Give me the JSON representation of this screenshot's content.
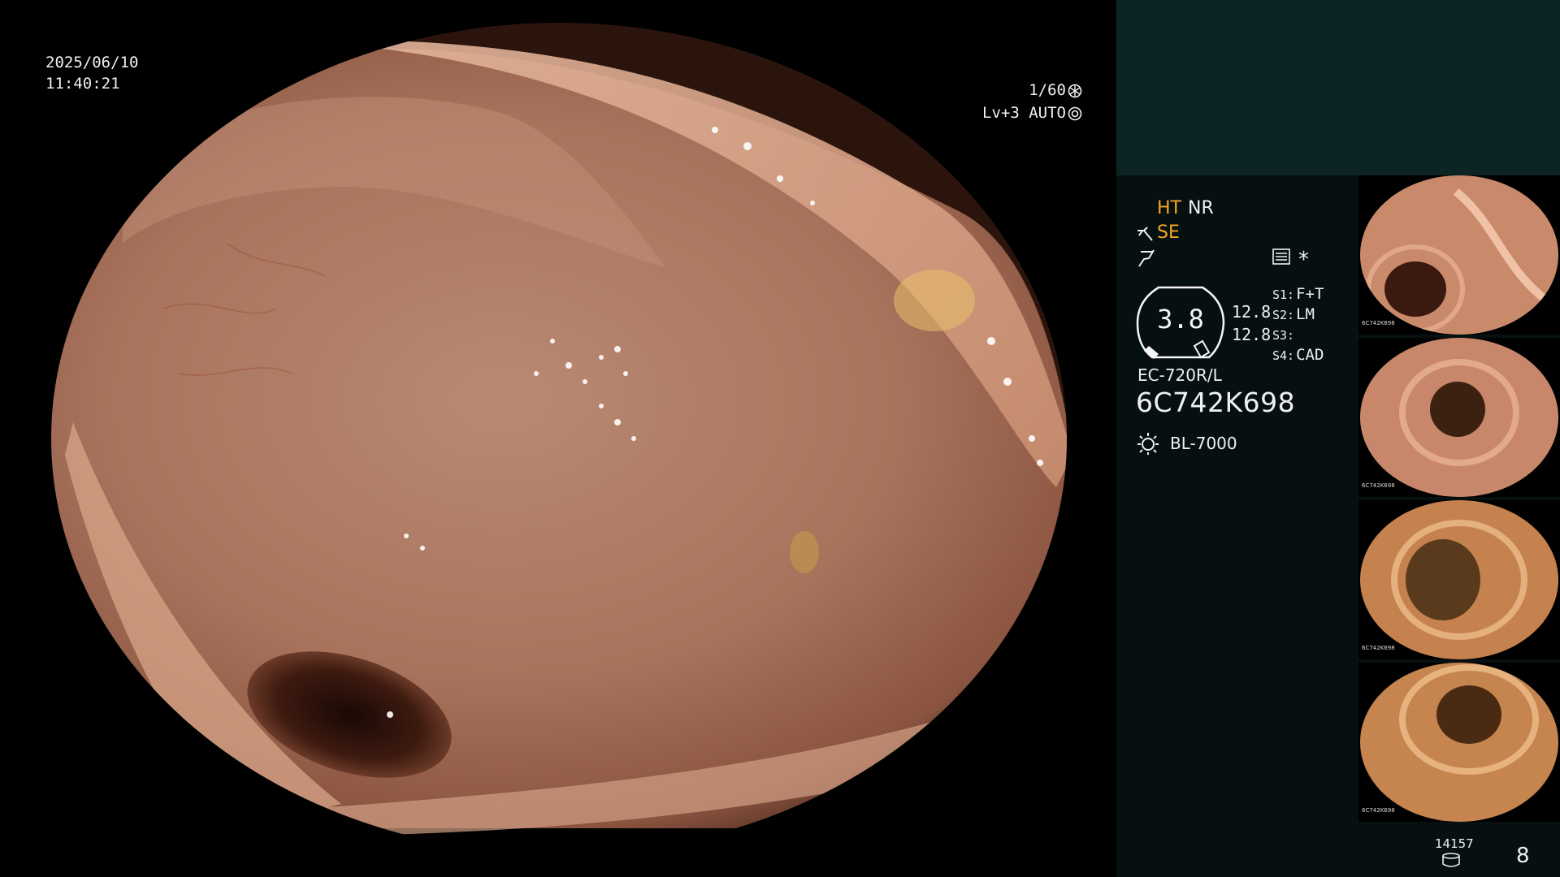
{
  "overlay": {
    "date": "2025/06/10",
    "time": "11:40:21",
    "shutter": "1/60",
    "shutter_icon": "aperture-icon",
    "level": "Lv+3 AUTO",
    "level_icon": "auto-iris-icon"
  },
  "status": {
    "ht": "HT",
    "nr": "NR",
    "se": "SE",
    "se_icon": "scope-tip-icon",
    "f_icon": "flash-icon",
    "menu_icon": "settings-list-icon",
    "star": "*",
    "gauge_value": "3.8",
    "num1": "12.8",
    "num2": "12.8",
    "slots": [
      {
        "key": "S1:",
        "value": "F+T"
      },
      {
        "key": "S2:",
        "value": "LM"
      },
      {
        "key": "S3:",
        "value": ""
      },
      {
        "key": "S4:",
        "value": "CAD"
      }
    ],
    "scope_model": "EC-720R/L",
    "serial": "6C742K698",
    "light_icon": "light-source-icon",
    "light_source": "BL-7000"
  },
  "thumbnails": [
    {
      "label": "6C742K698"
    },
    {
      "label": "6C742K698"
    },
    {
      "label": "6C742K698"
    },
    {
      "label": "6C742K698"
    }
  ],
  "footer": {
    "image_count": "14157",
    "storage_icon": "storage-icon",
    "page": "8"
  },
  "colors": {
    "accent": "#f5a623",
    "panel_top": "#0c2524",
    "panel": "#071011"
  }
}
